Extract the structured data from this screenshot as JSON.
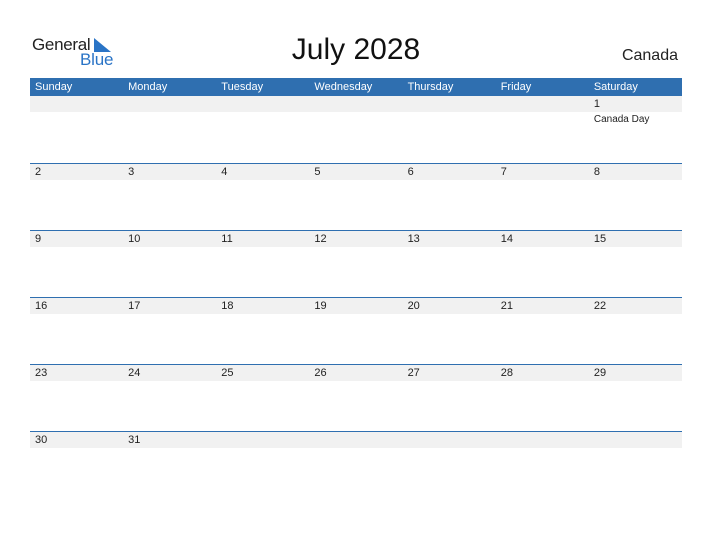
{
  "logo": {
    "text_general": "General",
    "text_blue": "Blue",
    "icon": "triangle-flag-icon"
  },
  "header": {
    "title": "July 2028",
    "country": "Canada"
  },
  "colors": {
    "accent": "#2f6fb0",
    "date_strip": "#f1f1f1",
    "logo_blue": "#2a74c6"
  },
  "weekdays": [
    "Sunday",
    "Monday",
    "Tuesday",
    "Wednesday",
    "Thursday",
    "Friday",
    "Saturday"
  ],
  "weeks": [
    [
      {
        "day": ""
      },
      {
        "day": ""
      },
      {
        "day": ""
      },
      {
        "day": ""
      },
      {
        "day": ""
      },
      {
        "day": ""
      },
      {
        "day": "1",
        "event": "Canada Day"
      }
    ],
    [
      {
        "day": "2"
      },
      {
        "day": "3"
      },
      {
        "day": "4"
      },
      {
        "day": "5"
      },
      {
        "day": "6"
      },
      {
        "day": "7"
      },
      {
        "day": "8"
      }
    ],
    [
      {
        "day": "9"
      },
      {
        "day": "10"
      },
      {
        "day": "11"
      },
      {
        "day": "12"
      },
      {
        "day": "13"
      },
      {
        "day": "14"
      },
      {
        "day": "15"
      }
    ],
    [
      {
        "day": "16"
      },
      {
        "day": "17"
      },
      {
        "day": "18"
      },
      {
        "day": "19"
      },
      {
        "day": "20"
      },
      {
        "day": "21"
      },
      {
        "day": "22"
      }
    ],
    [
      {
        "day": "23"
      },
      {
        "day": "24"
      },
      {
        "day": "25"
      },
      {
        "day": "26"
      },
      {
        "day": "27"
      },
      {
        "day": "28"
      },
      {
        "day": "29"
      }
    ],
    [
      {
        "day": "30"
      },
      {
        "day": "31"
      },
      {
        "day": ""
      },
      {
        "day": ""
      },
      {
        "day": ""
      },
      {
        "day": ""
      },
      {
        "day": ""
      }
    ]
  ]
}
